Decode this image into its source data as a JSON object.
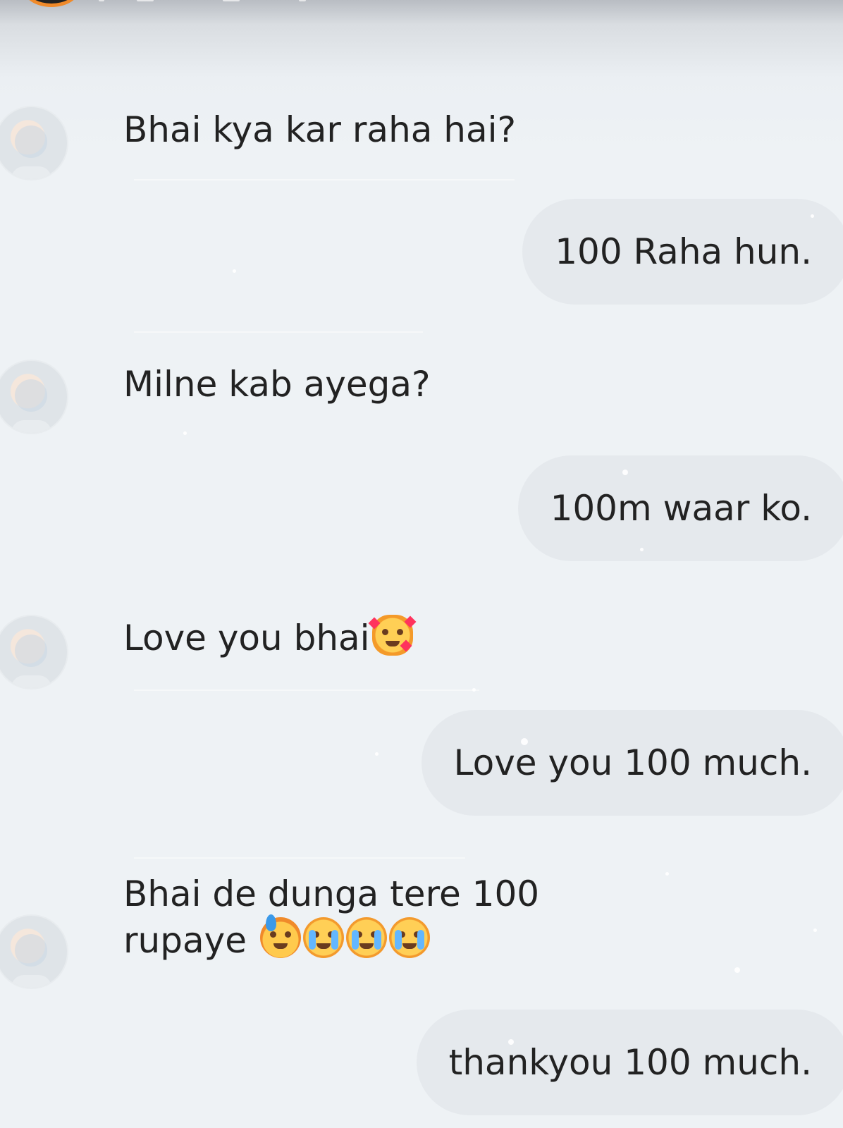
{
  "conversation": {
    "messages": [
      {
        "direction": "incoming",
        "text": "Bhai kya kar raha hai?"
      },
      {
        "direction": "outgoing",
        "text": "100 Raha hun."
      },
      {
        "direction": "incoming",
        "text": "Milne kab ayega?"
      },
      {
        "direction": "outgoing",
        "text": "100m waar ko."
      },
      {
        "direction": "incoming",
        "text": "Love you bhai",
        "emoji": [
          "smiling-face-with-hearts-icon"
        ]
      },
      {
        "direction": "outgoing",
        "text": "Love you 100 much."
      },
      {
        "direction": "incoming",
        "text_line_1": "Bhai de dunga tere 100",
        "text_line_2": "rupaye",
        "emoji": [
          "downcast-face-with-sweat-icon",
          "loudly-crying-face-icon",
          "loudly-crying-face-icon",
          "loudly-crying-face-icon"
        ]
      },
      {
        "direction": "outgoing",
        "text": "thankyou 100 much."
      }
    ]
  }
}
